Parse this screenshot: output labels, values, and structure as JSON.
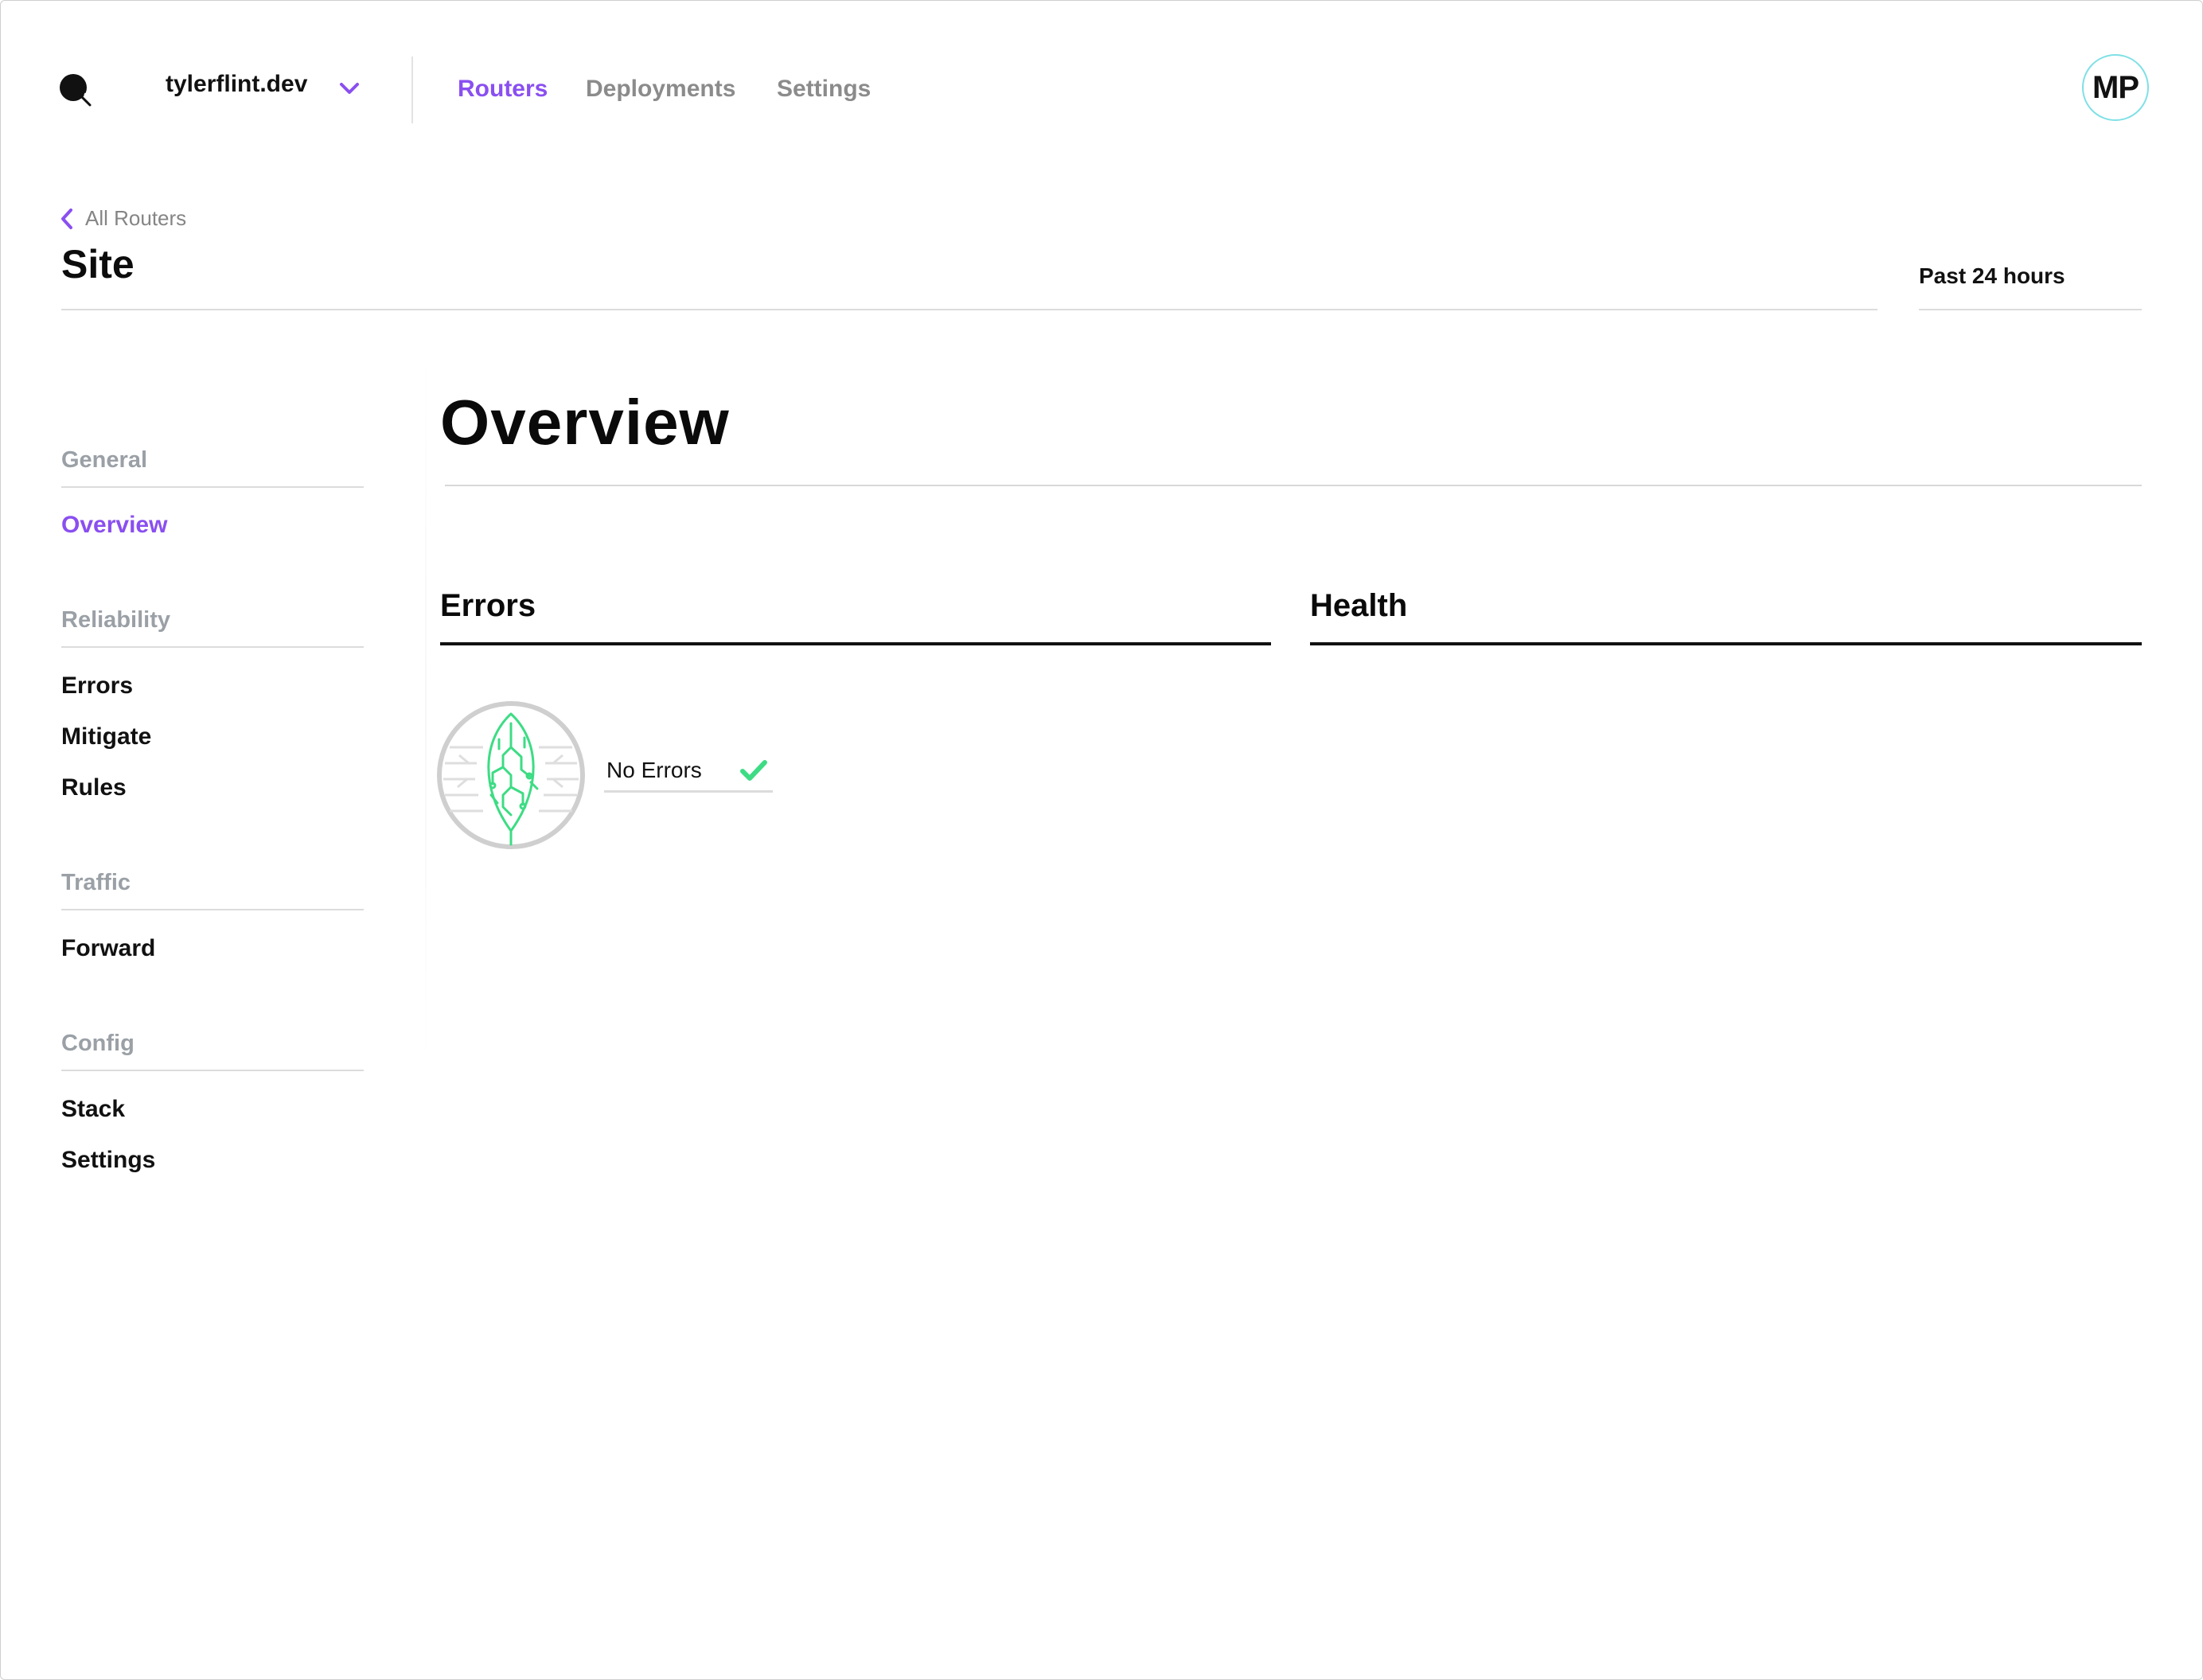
{
  "topbar": {
    "org_name": "tylerflint.dev",
    "nav": [
      {
        "label": "Routers",
        "active": true
      },
      {
        "label": "Deployments",
        "active": false
      },
      {
        "label": "Settings",
        "active": false
      }
    ],
    "avatar_initials": "MP"
  },
  "header": {
    "back_label": "All Routers",
    "title": "Site",
    "time_range": "Past 24 hours"
  },
  "sidebar": {
    "groups": [
      {
        "label": "General",
        "items": [
          {
            "label": "Overview",
            "active": true
          }
        ]
      },
      {
        "label": "Reliability",
        "items": [
          {
            "label": "Errors"
          },
          {
            "label": "Mitigate"
          },
          {
            "label": "Rules"
          }
        ]
      },
      {
        "label": "Traffic",
        "items": [
          {
            "label": "Forward"
          }
        ]
      },
      {
        "label": "Config",
        "items": [
          {
            "label": "Stack"
          },
          {
            "label": "Settings"
          }
        ]
      }
    ]
  },
  "main": {
    "title": "Overview",
    "errors": {
      "title": "Errors",
      "status": "No Errors"
    },
    "health": {
      "title": "Health"
    }
  },
  "icons": {
    "logo": "logo-icon",
    "org_dropdown": "chevron-down-icon",
    "back": "chevron-left-icon",
    "badge": "leaf-circuit-icon",
    "status": "check-icon"
  },
  "colors": {
    "accent": "#8a4ff0",
    "success": "#3ddc84",
    "muted": "#9aa0a6",
    "avatar_ring": "#7fe0e6"
  }
}
